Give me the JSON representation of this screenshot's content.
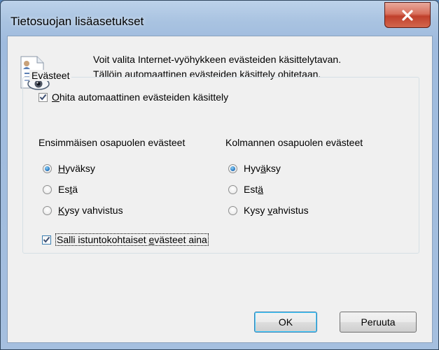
{
  "window": {
    "title": "Tietosuojan lisäasetukset",
    "close_glyph": "×"
  },
  "info": {
    "icon": "privacy-document-eye-icon",
    "line1": "Voit valita Internet-vyöhykkeen evästeiden käsittelytavan.",
    "line2": "Tällöin automaattinen evästeiden käsittely ohitetaan."
  },
  "cookies_group": {
    "legend": "Evästeet",
    "override": {
      "pre": "",
      "mnemonic": "O",
      "post": "hita automaattinen evästeiden käsittely",
      "checked": true
    },
    "first_party": {
      "heading": "Ensimmäisen osapuolen evästeet",
      "options": [
        {
          "pre": "",
          "mnemonic": "H",
          "post": "yväksy",
          "selected": true
        },
        {
          "pre": "Es",
          "mnemonic": "t",
          "post": "ä",
          "selected": false
        },
        {
          "pre": "",
          "mnemonic": "K",
          "post": "ysy vahvistus",
          "selected": false
        }
      ]
    },
    "third_party": {
      "heading": "Kolmannen osapuolen evästeet",
      "options": [
        {
          "pre": "Hyv",
          "mnemonic": "ä",
          "post": "ksy",
          "selected": true
        },
        {
          "pre": "Est",
          "mnemonic": "ä",
          "post": "",
          "selected": false
        },
        {
          "pre": "Kysy ",
          "mnemonic": "v",
          "post": "ahvistus",
          "selected": false
        }
      ]
    },
    "session": {
      "pre": "Salli istuntokohtaiset ",
      "mnemonic": "e",
      "post": "västeet aina",
      "checked": true
    }
  },
  "buttons": {
    "ok": "OK",
    "cancel": "Peruuta"
  },
  "colors": {
    "radio_selected": "#2d7cc4",
    "close_button": "#c7412d",
    "title_bar": "#a9c3e1"
  }
}
